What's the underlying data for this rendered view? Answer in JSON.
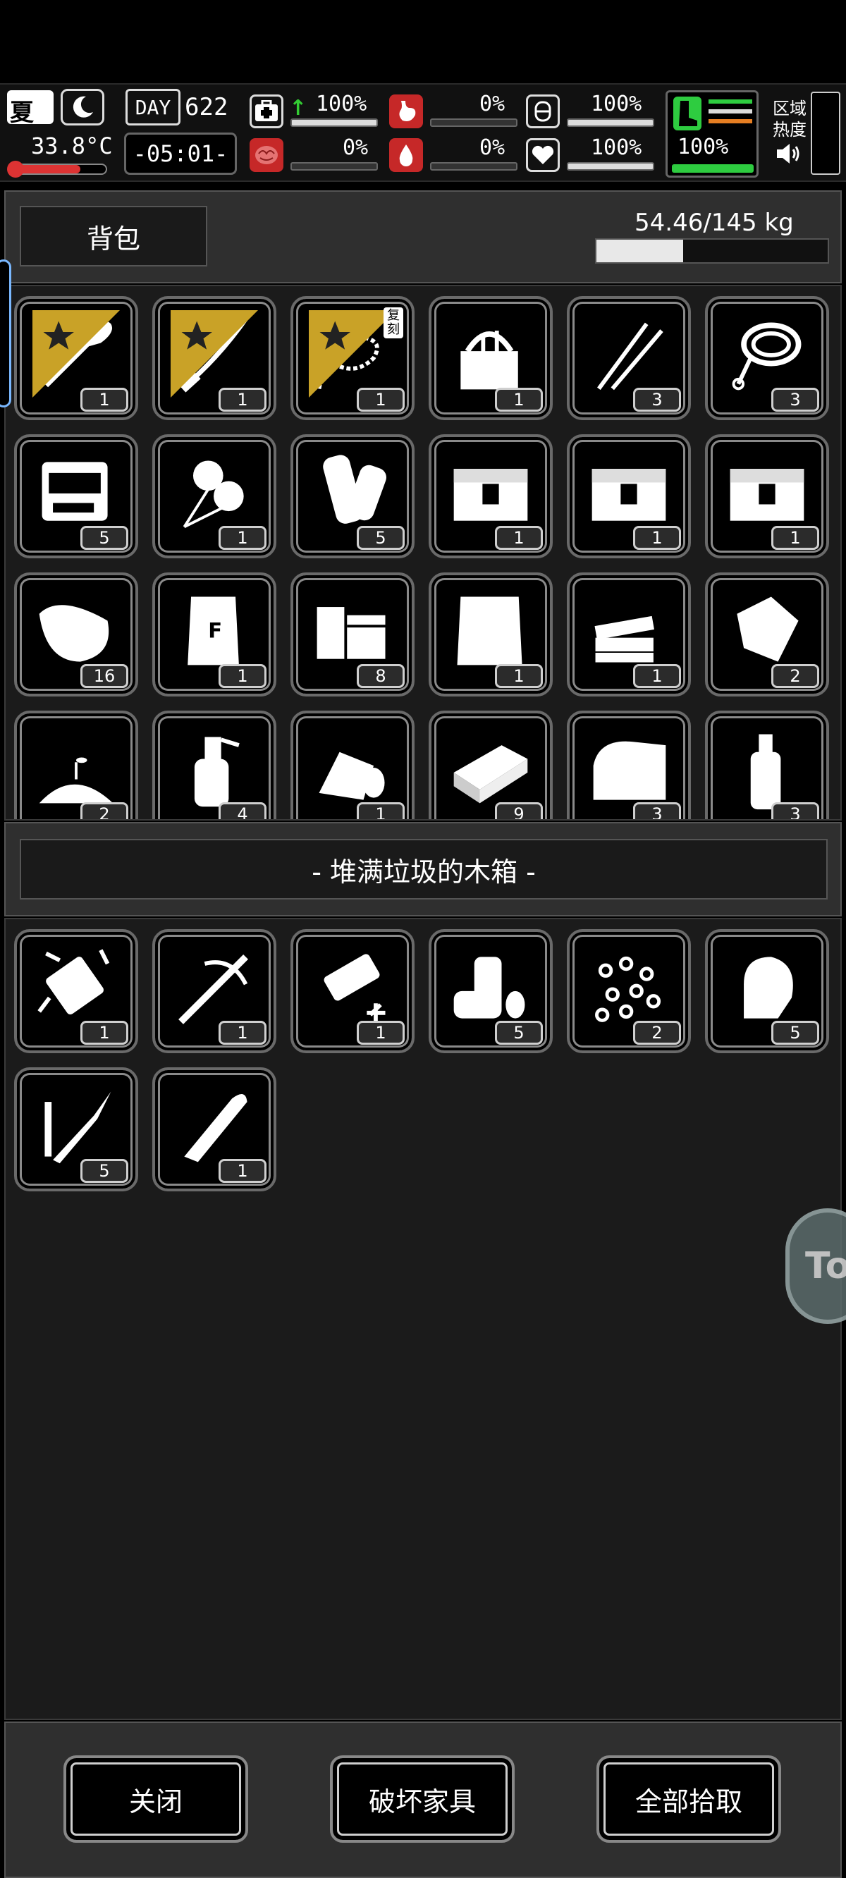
{
  "hud": {
    "season": "夏",
    "temperature": "33.8°C",
    "day_label": "DAY",
    "day_number": "622",
    "clock": "-05:01-",
    "health": "100%",
    "hunger": "0%",
    "stamina": "100%",
    "mental": "0%",
    "bleeding": "0%",
    "mood": "100%",
    "fatigue_text": "100%",
    "area_heat_label_line1": "区域",
    "area_heat_label_line2": "热度",
    "progress": {
      "health": 1.0,
      "hunger": 0.0,
      "stamina": 1.0,
      "mental": 0.0,
      "bleeding": 0.0,
      "mood": 1.0,
      "fatigue": 1.0
    }
  },
  "backpack": {
    "tab_label": "背包",
    "weight": "54.46/145 kg",
    "weight_fraction": 0.3756,
    "items": [
      {
        "icon": "shovel-icon",
        "count": "1",
        "starred": true
      },
      {
        "icon": "katana-icon",
        "count": "1",
        "starred": true
      },
      {
        "icon": "thorn-whip-icon",
        "count": "1",
        "starred": true,
        "tag": "复刻"
      },
      {
        "icon": "toolbox-bag-icon",
        "count": "1"
      },
      {
        "icon": "lockpick-icon",
        "count": "3"
      },
      {
        "icon": "rope-icon",
        "count": "3"
      },
      {
        "icon": "repair-kit-icon",
        "count": "5"
      },
      {
        "icon": "cotton-icon",
        "count": "1"
      },
      {
        "icon": "bark-roll-icon",
        "count": "5"
      },
      {
        "icon": "supply-crate-icon",
        "count": "1"
      },
      {
        "icon": "supply-crate-icon",
        "count": "1"
      },
      {
        "icon": "supply-crate-icon",
        "count": "1"
      },
      {
        "icon": "potato-sack-icon",
        "count": "16"
      },
      {
        "icon": "flour-bag-icon",
        "count": "1"
      },
      {
        "icon": "wood-planks-icon",
        "count": "8"
      },
      {
        "icon": "cloth-icon",
        "count": "1"
      },
      {
        "icon": "stone-slabs-icon",
        "count": "1"
      },
      {
        "icon": "scrap-icon",
        "count": "2"
      },
      {
        "icon": "soil-sprout-icon",
        "count": "2"
      },
      {
        "icon": "spray-bottle-icon",
        "count": "4"
      },
      {
        "icon": "bandage-roll-icon",
        "count": "1"
      },
      {
        "icon": "brick-icon",
        "count": "9"
      },
      {
        "icon": "towel-icon",
        "count": "3"
      },
      {
        "icon": "water-bottle-icon",
        "count": "3"
      }
    ]
  },
  "container": {
    "title": "- 堆满垃圾的木箱 -",
    "items": [
      {
        "icon": "spiked-battery-icon",
        "count": "1"
      },
      {
        "icon": "crossbow-icon",
        "count": "1"
      },
      {
        "icon": "blade-upgrade-icon",
        "count": "1"
      },
      {
        "icon": "cans-icon",
        "count": "5"
      },
      {
        "icon": "beads-icon",
        "count": "2"
      },
      {
        "icon": "bullet-tip-icon",
        "count": "5"
      },
      {
        "icon": "rocket-launcher-icon",
        "count": "5"
      },
      {
        "icon": "bullet-icon",
        "count": "1"
      }
    ]
  },
  "floating_button": "To",
  "buttons": {
    "close": "关闭",
    "destroy": "破坏家具",
    "take_all": "全部拾取"
  }
}
